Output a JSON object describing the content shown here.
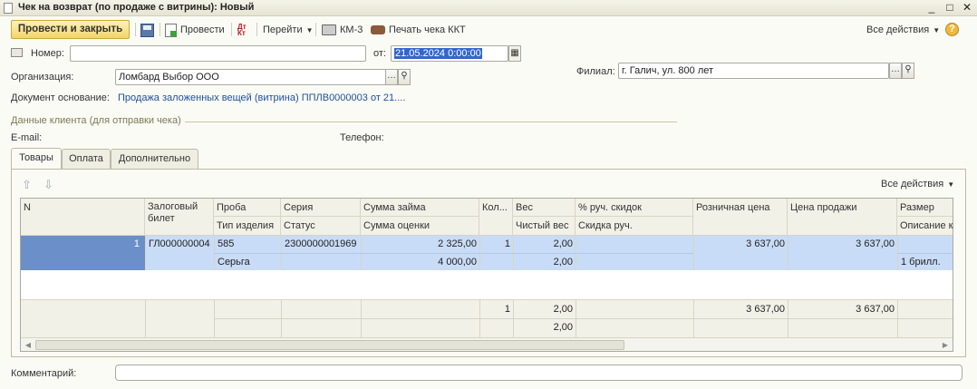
{
  "window": {
    "title": "Чек на возврат (по продаже с витрины): Новый",
    "controls": [
      "_",
      "□",
      "✕"
    ]
  },
  "toolbar": {
    "post_close": "Провести и закрыть",
    "post": "Провести",
    "goto": "Перейти",
    "km3": "КМ-3",
    "print_check": "Печать чека ККТ",
    "all_actions": "Все действия",
    "help": "?",
    "dtkt_top": "Дт",
    "dtkt_bottom": "Кт"
  },
  "form": {
    "number_label": "Номер:",
    "number_value": "",
    "date_label": "от:",
    "date_value": "21.05.2024  0:00:00",
    "org_label": "Организация:",
    "org_value": "Ломбард Выбор ООО",
    "branch_label": "Филиал:",
    "branch_value": "г. Галич, ул. 800 лет",
    "base_doc_label": "Документ основание:",
    "base_doc_value": "Продажа заложенных вещей (витрина) ППЛВ0000003 от 21....",
    "client_group_title": "Данные клиента (для отправки чека)",
    "email_label": "E-mail:",
    "phone_label": "Телефон:",
    "comment_label": "Комментарий:",
    "comment_value": ""
  },
  "tabs": [
    "Товары",
    "Оплата",
    "Дополнительно"
  ],
  "grid": {
    "all_actions": "Все действия",
    "headers_top": [
      "N",
      "Залоговый билет",
      "Проба",
      "Серия",
      "Сумма займа",
      "Кол...",
      "Вес",
      "% руч. скидок",
      "Розничная цена",
      "Цена продажи",
      "Размер"
    ],
    "headers_bottom": [
      "Тип изделия",
      "Статус",
      "Сумма оценки",
      "Чистый вес",
      "Скидка руч.",
      "Описание к"
    ],
    "row1": {
      "n": "1",
      "ticket": "ГЛ000000004",
      "proba": "585",
      "series": "2300000001969",
      "loan_sum": "2 325,00",
      "qty": "1",
      "weight": "2,00",
      "retail_price": "3 637,00",
      "sale_price": "3 637,00"
    },
    "row2": {
      "item_type": "Серьга",
      "appraisal_sum": "4 000,00",
      "net_weight": "2,00",
      "description": "1 брилл."
    },
    "totals": {
      "qty": "1",
      "weight": "2,00",
      "net_weight": "2,00",
      "retail_price": "3 637,00",
      "sale_price": "3 637,00"
    }
  },
  "colors": {
    "accent_button": "#f2d566",
    "selected_row": "#c9dcf7",
    "selected_cell": "#6b8fc9",
    "link": "#1c4f9c"
  }
}
